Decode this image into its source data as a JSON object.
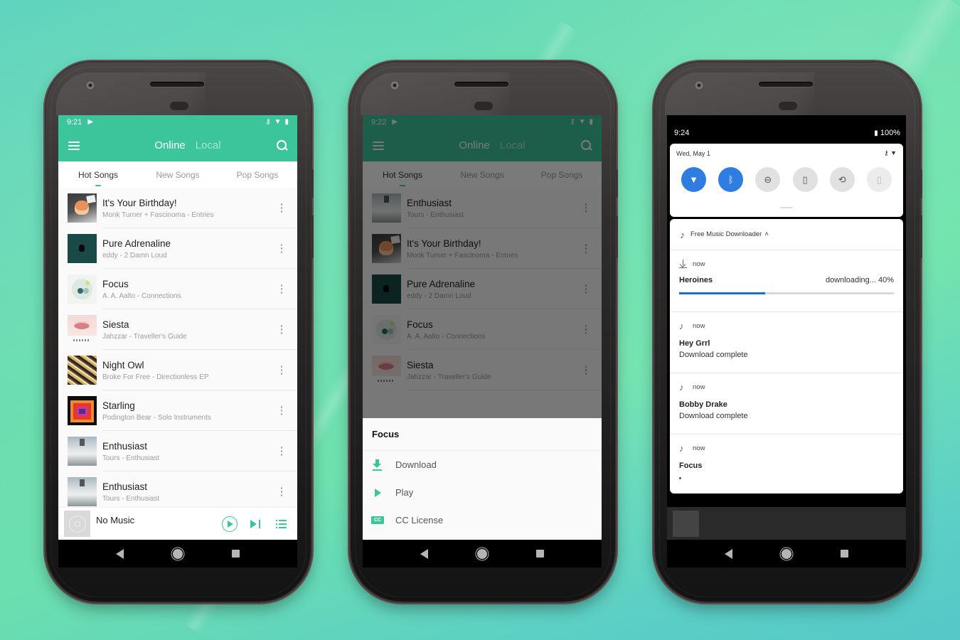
{
  "colors": {
    "accent": "#3cc49a",
    "progress": "#1a6fd6",
    "qs_active": "#2f7de1"
  },
  "phone1": {
    "status": {
      "time": "9:21",
      "icons": [
        "play-store-icon",
        "vpn-key-icon",
        "wifi-icon",
        "battery-charging-icon"
      ]
    },
    "toolbar": {
      "menu_icon": "hamburger-icon",
      "tabs": [
        "Online",
        "Local"
      ],
      "active_tab": "Online",
      "search_icon": "search-icon"
    },
    "tabs": [
      {
        "label": "Hot Songs",
        "active": true
      },
      {
        "label": "New Songs",
        "active": false
      },
      {
        "label": "Pop Songs",
        "active": false
      }
    ],
    "songs": [
      {
        "title": "It's Your Birthday!",
        "subtitle": "Monk Turner + Fascinoma - Entries"
      },
      {
        "title": "Pure Adrenaline",
        "subtitle": "eddy - 2 Damn Loud"
      },
      {
        "title": "Focus",
        "subtitle": "A. A. Aalto - Connections"
      },
      {
        "title": "Siesta",
        "subtitle": "Jahzzar - Traveller's Guide"
      },
      {
        "title": "Night Owl",
        "subtitle": "Broke For Free - Directionless EP"
      },
      {
        "title": "Starling",
        "subtitle": "Podington Bear - Solo Instruments"
      },
      {
        "title": "Enthusiast",
        "subtitle": "Tours - Enthusiast"
      },
      {
        "title": "Enthusiast",
        "subtitle": "Tours - Enthusiast"
      }
    ],
    "player": {
      "title": "No Music",
      "play_icon": "play-circle-icon",
      "next_icon": "skip-next-icon",
      "queue_icon": "playlist-icon"
    }
  },
  "phone2": {
    "status": {
      "time": "9:22"
    },
    "toolbar": {
      "tabs": [
        "Online",
        "Local"
      ]
    },
    "tabs": [
      {
        "label": "Hot Songs",
        "active": true
      },
      {
        "label": "New Songs",
        "active": false
      },
      {
        "label": "Pop Songs",
        "active": false
      }
    ],
    "songs": [
      {
        "title": "Enthusiast",
        "subtitle": "Tours - Enthusiast"
      },
      {
        "title": "It's Your Birthday!",
        "subtitle": "Monk Turner + Fascinoma - Entries"
      },
      {
        "title": "Pure Adrenaline",
        "subtitle": "eddy - 2 Damn Loud"
      },
      {
        "title": "Focus",
        "subtitle": "A. A. Aalto - Connections"
      },
      {
        "title": "Siesta",
        "subtitle": "Jahzzar - Traveller's Guide"
      }
    ],
    "sheet": {
      "title": "Focus",
      "items": [
        {
          "label": "Download",
          "icon": "download-icon"
        },
        {
          "label": "Play",
          "icon": "play-icon"
        },
        {
          "label": "CC License",
          "icon": "cc-icon",
          "badge": "CC"
        }
      ]
    }
  },
  "phone3": {
    "status": {
      "time": "9:24",
      "battery": "100%"
    },
    "quick_settings": {
      "date": "Wed, May 1",
      "tiles": [
        {
          "name": "wifi",
          "icon": "wifi-off-icon",
          "state": "on",
          "glyph": "▼"
        },
        {
          "name": "bluetooth",
          "icon": "bluetooth-icon",
          "state": "on",
          "glyph": "ᛒ"
        },
        {
          "name": "do-not-disturb",
          "icon": "dnd-icon",
          "state": "off",
          "glyph": "⊖"
        },
        {
          "name": "flashlight",
          "icon": "flashlight-icon",
          "state": "off",
          "glyph": "▯"
        },
        {
          "name": "auto-rotate",
          "icon": "rotate-icon",
          "state": "off",
          "glyph": "⟲"
        },
        {
          "name": "battery-saver",
          "icon": "battery-saver-icon",
          "state": "disabled",
          "glyph": "▯"
        }
      ]
    },
    "notifications": {
      "app_name": "Free Music Downloader",
      "expand_glyph": "˄",
      "items": [
        {
          "time": "now",
          "icon": "download-icon",
          "title": "Heroines",
          "status": "downloading... 40%",
          "progress": 0.4
        },
        {
          "time": "now",
          "icon": "music-note-icon",
          "title": "Hey Grrl",
          "text": "Download complete"
        },
        {
          "time": "now",
          "icon": "music-note-icon",
          "title": "Bobby Drake",
          "text": "Download complete"
        },
        {
          "time": "now",
          "icon": "music-note-icon",
          "title": "Focus",
          "text": ""
        }
      ]
    }
  }
}
